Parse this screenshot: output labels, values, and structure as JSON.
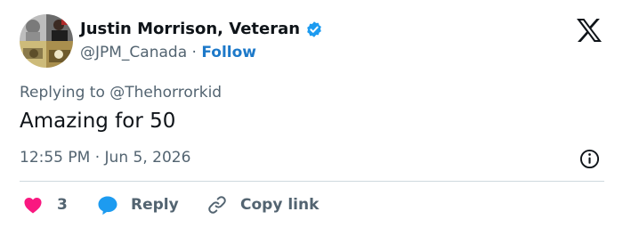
{
  "author": {
    "name": "Justin Morrison, Veteran",
    "handle": "@JPM_Canada",
    "separator": "·",
    "follow_label": "Follow"
  },
  "icons": {
    "verified": "verified-badge-icon",
    "brand": "x-logo-icon",
    "info": "info-icon",
    "like": "heart-icon",
    "reply": "chat-bubble-icon",
    "copy": "link-icon"
  },
  "reply_context": {
    "prefix": "Replying to",
    "target": "@Thehorrorkid"
  },
  "tweet": {
    "text": "Amazing for 50",
    "time": "12:55 PM",
    "separator": "·",
    "date": "Jun 5, 2026"
  },
  "actions": {
    "like_count": "3",
    "reply_label": "Reply",
    "copy_label": "Copy link"
  },
  "colors": {
    "like": "#f91880",
    "reply": "#1d9bf0",
    "verified": "#1d9bf0",
    "follow": "#1d79c9",
    "secondary_text": "#536471"
  }
}
